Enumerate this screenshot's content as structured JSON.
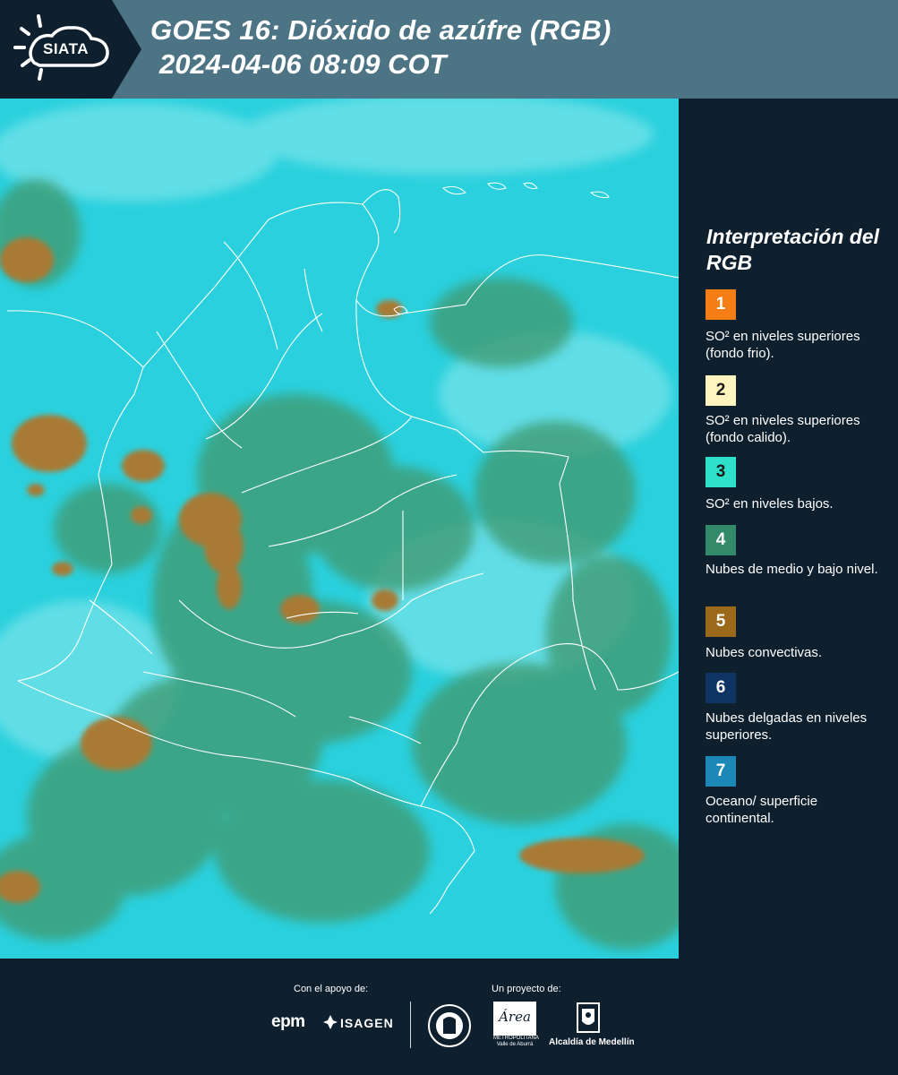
{
  "header": {
    "title": "GOES 16: Dióxido de azúfre (RGB)",
    "subtitle": "2024-04-06 08:09 COT",
    "logo_text": "SIATA",
    "background": "#4d7485",
    "logo_background": "#0e1f2e"
  },
  "map": {
    "description_icon": "satellite-rgb-map",
    "base_color": "#2ad0dd",
    "cloud_color": "#3f9b73",
    "convective_color": "#a87a36",
    "border_color": "#ffffff"
  },
  "legend": {
    "title": "Interpretación del RGB",
    "items": [
      {
        "number": "1",
        "color": "#f47d16",
        "label": "SO² en niveles superiores (fondo frio)."
      },
      {
        "number": "2",
        "color": "#fdf4c0",
        "label": "SO² en niveles superiores (fondo calido)."
      },
      {
        "number": "3",
        "color": "#2ee0c9",
        "label": "SO² en niveles bajos."
      },
      {
        "number": "4",
        "color": "#338a6a",
        "label": "Nubes de medio y bajo nivel."
      },
      {
        "number": "5",
        "color": "#9a6a1a",
        "label": "Nubes convectivas."
      },
      {
        "number": "6",
        "color": "#0f3463",
        "label": "Nubes delgadas en niveles superiores."
      },
      {
        "number": "7",
        "color": "#1b88b8",
        "label": "Oceano/ superficie continental."
      }
    ]
  },
  "footer": {
    "support_label": "Con el apoyo de:",
    "project_label": "Un proyecto de:",
    "epm_text": "epm",
    "isagen_text": "ISAGEN",
    "area_text": "Área",
    "metropolitana_text": "METROPOLITANA",
    "valle_text": "Valle de Aburrá",
    "alcaldia_text": "Alcaldía de Medellín"
  }
}
